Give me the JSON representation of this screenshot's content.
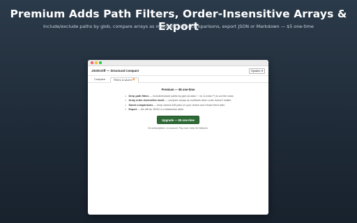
{
  "banner": {
    "title": "Premium Adds Path Filters, Order-Insensitive Arrays & Export",
    "subtitle": "Include/exclude paths by glob, compare arrays as multisets, save comparisons, export JSON or Markdown — $5 one-time"
  },
  "app": {
    "title": "JSON Diff — Structural Compare",
    "theme_value": "System",
    "theme_chevron": "▾"
  },
  "tabs": [
    {
      "label": "Compare"
    },
    {
      "label": "Filters & saved",
      "badge": "🔥"
    }
  ],
  "premium": {
    "heading": "Premium — $5 one-time",
    "features": [
      {
        "name": "Deep path filters",
        "desc": "— include/exclude paths by glob (&.data.*, !.id, &.meta.**) to cut the noise."
      },
      {
        "name": "Array order-insensitive mode",
        "desc": "— compare arrays as multisets when order doesn't matter."
      },
      {
        "name": "Saved comparisons",
        "desc": "— keep named A/B pairs on your device and reload them later."
      },
      {
        "name": "Export",
        "desc": "— the diff as JSON or a Markdown table."
      }
    ],
    "button_label": "Upgrade — $5 one-time",
    "note": "No subscriptions, no account. Pay once, keep the features."
  },
  "colors": {
    "button_bg": "#2d6a35",
    "background_top": "#2b3a4a",
    "background_bottom": "#18222d"
  }
}
